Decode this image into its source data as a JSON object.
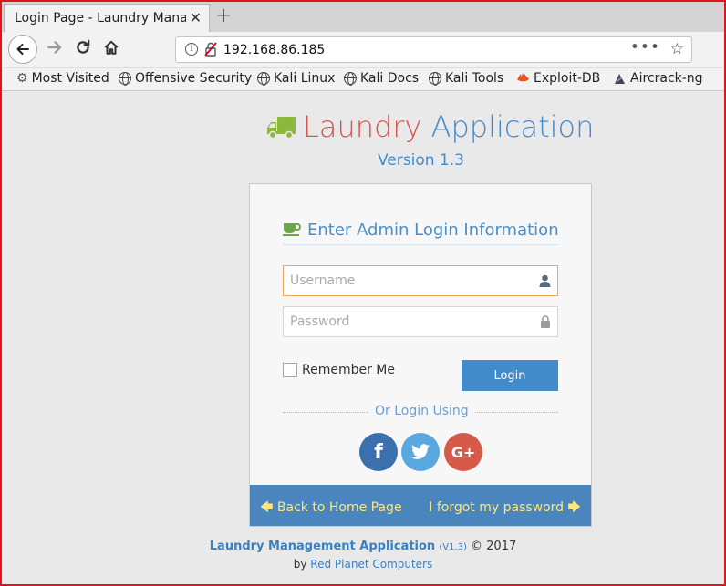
{
  "browser": {
    "tab_title": "Login Page - Laundry Management",
    "url": "192.168.86.185",
    "bookmarks": [
      {
        "label": "Most Visited",
        "icon": "gear-icon"
      },
      {
        "label": "Offensive Security",
        "icon": "globe-icon"
      },
      {
        "label": "Kali Linux",
        "icon": "globe-icon"
      },
      {
        "label": "Kali Docs",
        "icon": "globe-icon"
      },
      {
        "label": "Kali Tools",
        "icon": "globe-icon"
      },
      {
        "label": "Exploit-DB",
        "icon": "exploit-db-icon"
      },
      {
        "label": "Aircrack-ng",
        "icon": "aircrack-icon"
      }
    ]
  },
  "header": {
    "title_part1": "Laundry",
    "title_part2": "Application",
    "version": "Version 1.3"
  },
  "login_card": {
    "heading": "Enter Admin Login Information",
    "username_placeholder": "Username",
    "password_placeholder": "Password",
    "remember_label": "Remember Me",
    "login_button": "Login",
    "or_login": "Or Login Using",
    "social": [
      "f",
      "twitter",
      "G+"
    ],
    "back_link": "Back to Home Page",
    "forgot_link": "I forgot my password"
  },
  "footer": {
    "app_name": "Laundry Management Application",
    "version": "(V1.3)",
    "copyright": "© 2017",
    "by": "by",
    "company": "Red Planet Computers"
  },
  "colors": {
    "title_red": "#d9534f",
    "title_blue": "#428bca",
    "footer_bar": "#4a86bd",
    "link_yellow": "#ffe67a",
    "facebook": "#3b6fae",
    "twitter": "#5aa8e0",
    "google": "#d65a4a"
  }
}
